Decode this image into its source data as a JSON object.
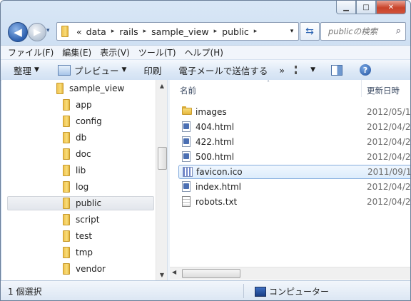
{
  "window": {
    "caption_buttons": {
      "minimize": "▁",
      "maximize": "□",
      "close": "✕"
    }
  },
  "nav": {
    "back_icon": "back-arrow-icon",
    "forward_icon": "forward-arrow-icon",
    "history_drop": "▾",
    "address": {
      "overflow": "«",
      "crumbs": [
        "data",
        "rails",
        "sample_view",
        "public"
      ],
      "separator": "▸",
      "dropdown": "▾"
    },
    "refresh": "⇆",
    "search_placeholder": "publicの検索",
    "search_icon": "⌕"
  },
  "menubar": [
    "ファイル(F)",
    "編集(E)",
    "表示(V)",
    "ツール(T)",
    "ヘルプ(H)"
  ],
  "toolbar": {
    "organize": "整理",
    "preview": "プレビュー",
    "print": "印刷",
    "email": "電子メールで送信する",
    "more": "»",
    "dropdown": "▼",
    "help": "?"
  },
  "tree": {
    "root": "sample_view",
    "items": [
      "app",
      "config",
      "db",
      "doc",
      "lib",
      "log",
      "public",
      "script",
      "test",
      "tmp",
      "vendor"
    ],
    "selected": "public",
    "scroll_up": "▲",
    "scroll_down": "▼"
  },
  "files": {
    "columns": {
      "name": "名前",
      "date": "更新日時",
      "sort_caret": "˄"
    },
    "rows": [
      {
        "name": "images",
        "date": "2012/05/1",
        "type": "folder"
      },
      {
        "name": "404.html",
        "date": "2012/04/2",
        "type": "html"
      },
      {
        "name": "422.html",
        "date": "2012/04/2",
        "type": "html"
      },
      {
        "name": "500.html",
        "date": "2012/04/2",
        "type": "html"
      },
      {
        "name": "favicon.ico",
        "date": "2011/09/1",
        "type": "ico",
        "selected": true
      },
      {
        "name": "index.html",
        "date": "2012/04/2",
        "type": "html"
      },
      {
        "name": "robots.txt",
        "date": "2012/04/2",
        "type": "txt"
      }
    ],
    "scroll_left": "◀"
  },
  "status": {
    "count": "1 個選択",
    "location": "コンピューター"
  },
  "colors": {
    "selection_border": "#84acdd",
    "toolbar_top": "#f4f8fd",
    "toolbar_bottom": "#d2e1f3",
    "close_red": "#c8432a"
  }
}
